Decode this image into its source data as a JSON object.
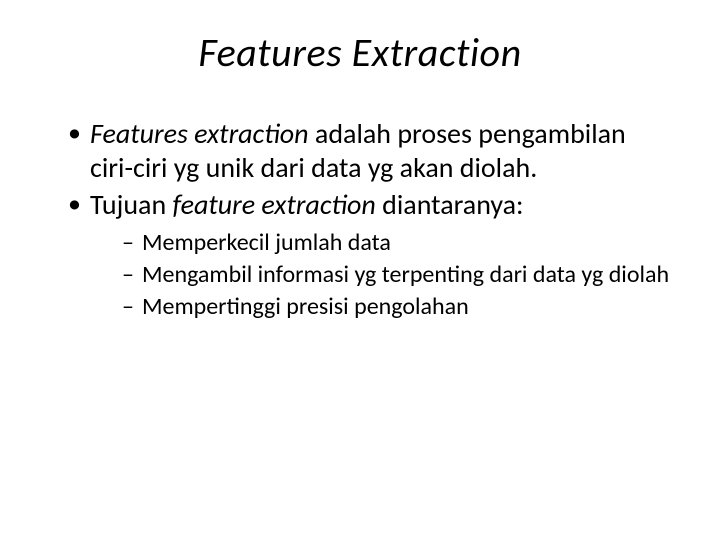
{
  "title": "Features Extraction",
  "bullets": [
    {
      "prefix_italic": "Features extraction",
      "rest": " adalah proses pengambilan ciri-ciri yg unik dari data yg akan diolah."
    },
    {
      "pre": "Tujuan ",
      "italic": "feature extraction",
      "post": " diantaranya:"
    }
  ],
  "subbullets": [
    "Memperkecil jumlah data",
    "Mengambil informasi yg terpenting dari data yg diolah",
    "Mempertinggi presisi pengolahan"
  ]
}
